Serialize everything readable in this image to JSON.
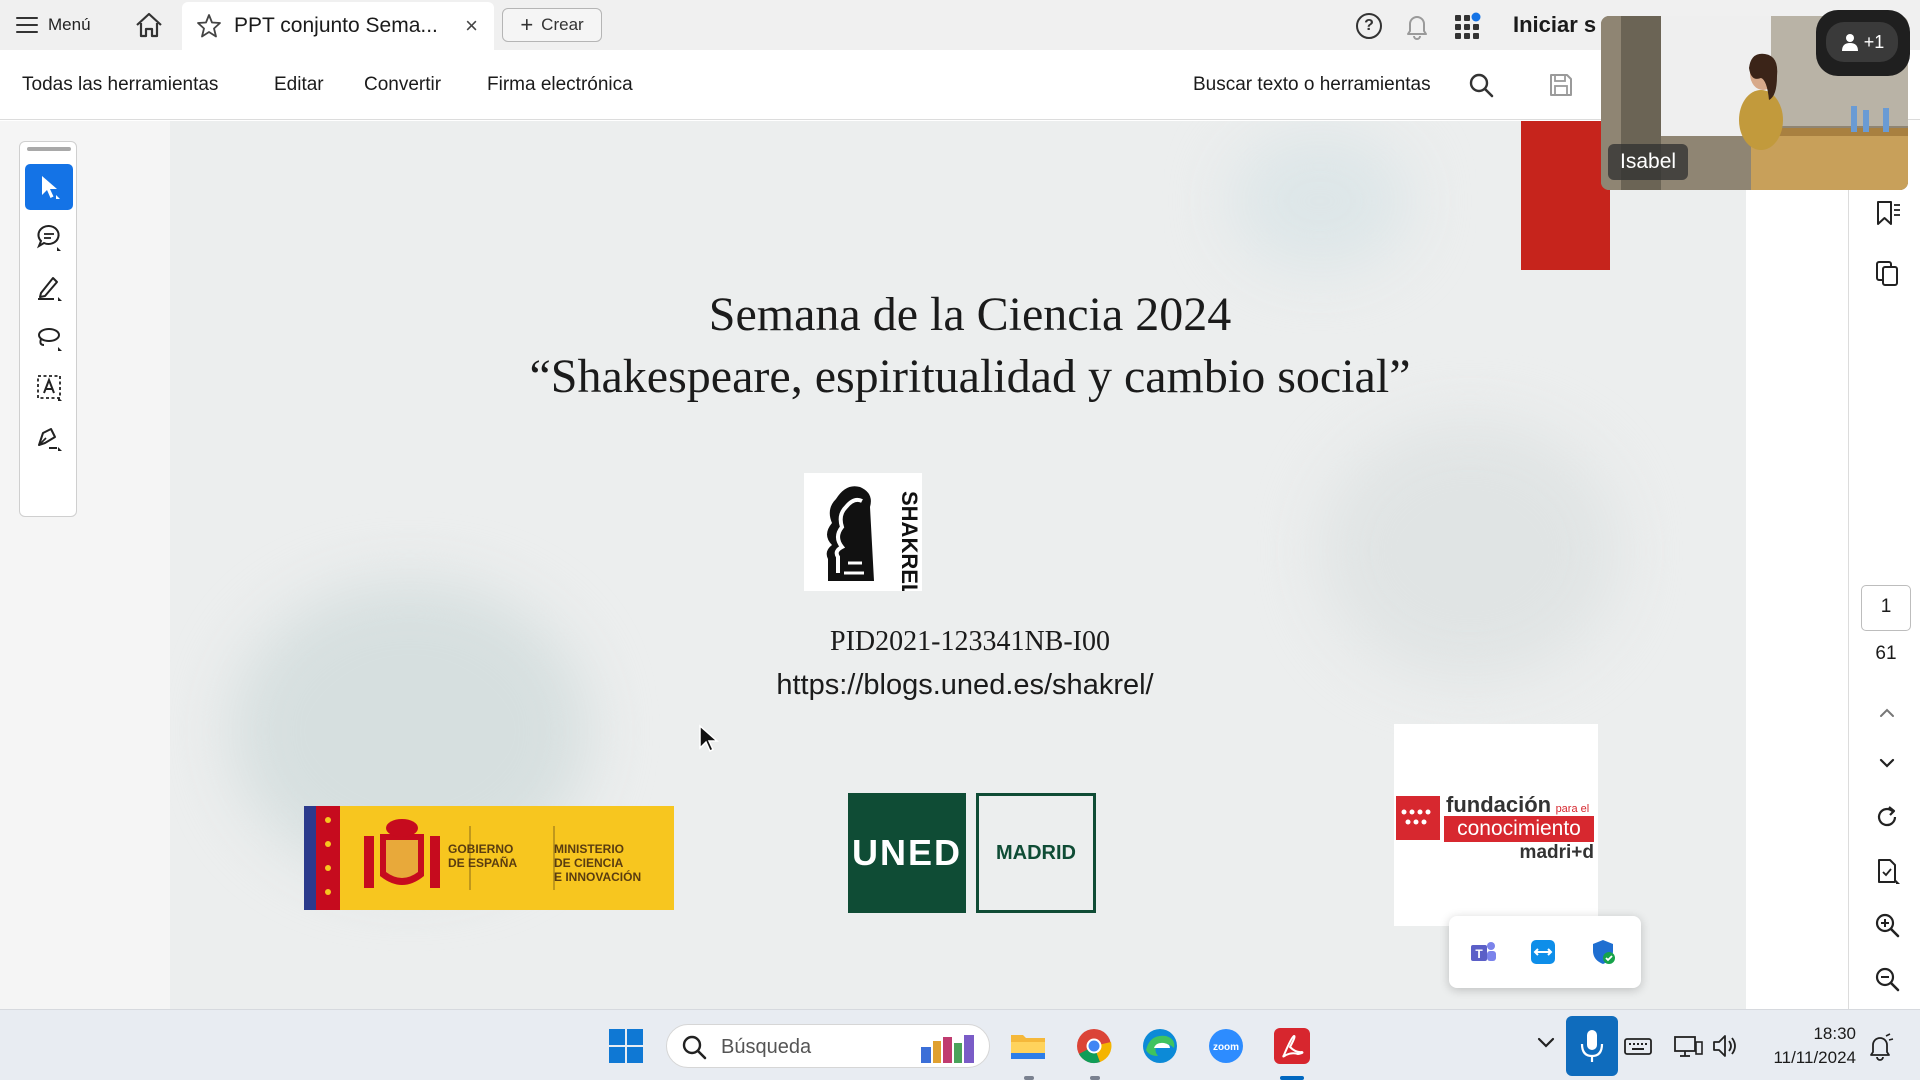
{
  "titlebar": {
    "menu_label": "Menú",
    "tab_title": "PPT conjunto Sema...",
    "tab_close": "×",
    "create_label": "Crear",
    "help_glyph": "?",
    "signin_label": "Iniciar s"
  },
  "toolbar": {
    "all_tools": "Todas las herramientas",
    "edit": "Editar",
    "convert": "Convertir",
    "esign": "Firma electrónica",
    "search_tools": "Buscar texto o herramientas"
  },
  "slide": {
    "title_line1": "Semana de la Ciencia 2024",
    "title_line2": "“Shakespeare, espiritualidad y cambio social”",
    "logo_shakrel_text": "SHAKREL",
    "project_id": "PID2021-123341NB-I00",
    "url": "https://blogs.uned.es/shakrel/",
    "logo_gobierno_1": "GOBIERNO",
    "logo_gobierno_2": "DE ESPAÑA",
    "logo_ministerio_1": "MINISTERIO",
    "logo_ministerio_2": "DE CIENCIA",
    "logo_ministerio_3": "E INNOVACIÓN",
    "logo_uned": "UNED",
    "logo_madrid": "MADRID",
    "logo_fundacion_1": "fundación",
    "logo_fundacion_para": "para el",
    "logo_fundacion_2": "conocimiento",
    "logo_fundacion_3": "madri+d"
  },
  "page_nav": {
    "current_page": "1",
    "total_pages": "61"
  },
  "webcam": {
    "participant_name": "Isabel",
    "extra_participants": "+1"
  },
  "taskbar": {
    "search_placeholder": "Búsqueda",
    "zoom_label": "zoom",
    "time": "18:30",
    "date": "11/11/2024"
  },
  "colors": {
    "accent_blue": "#1473e6",
    "acrobat_red": "#c6241c",
    "uned_green": "#0f4c35",
    "gob_yellow": "#f7c61f",
    "gob_red": "#c60b1e"
  }
}
